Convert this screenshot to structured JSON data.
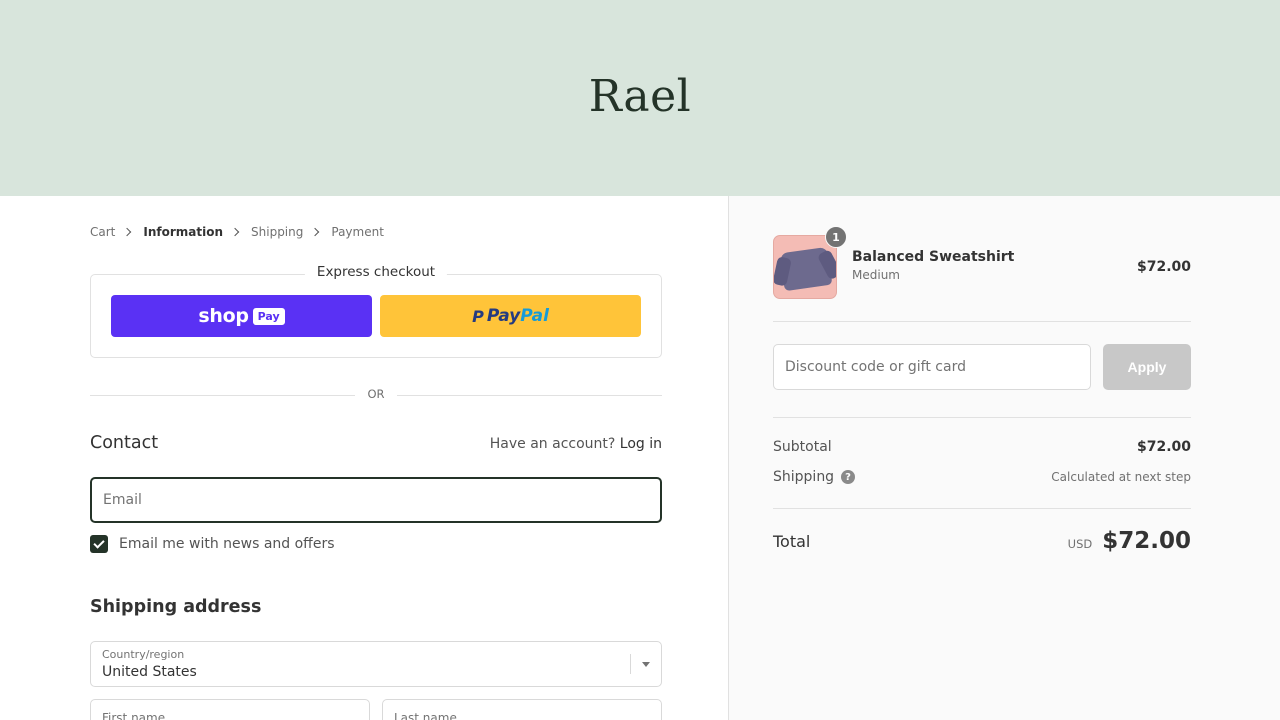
{
  "brand": {
    "name": "Rael"
  },
  "breadcrumb": [
    {
      "label": "Cart"
    },
    {
      "label": "Information"
    },
    {
      "label": "Shipping"
    },
    {
      "label": "Payment"
    }
  ],
  "express": {
    "title": "Express checkout",
    "shop_pay": {
      "word": "shop",
      "badge": "Pay"
    },
    "paypal": {
      "word1": "Pay",
      "word2": "Pal"
    }
  },
  "divider_text": "OR",
  "contact": {
    "heading": "Contact",
    "have_account": "Have an account?",
    "login_link": "Log in",
    "email_placeholder": "Email",
    "newsletter_label": "Email me with news and offers",
    "newsletter_checked": true
  },
  "shipping": {
    "heading": "Shipping address",
    "country_label": "Country/region",
    "country_value": "United States",
    "first_name_label": "First name",
    "last_name_label": "Last name"
  },
  "order": {
    "product": {
      "name": "Balanced Sweatshirt",
      "variant": "Medium",
      "price": "$72.00",
      "quantity": "1"
    },
    "discount_placeholder": "Discount code or gift card",
    "apply_label": "Apply",
    "subtotal_label": "Subtotal",
    "subtotal_value": "$72.00",
    "shipping_label": "Shipping",
    "shipping_value": "Calculated at next step",
    "total_label": "Total",
    "currency": "USD",
    "total_value": "$72.00"
  },
  "colors": {
    "banner": "#d8e5dc",
    "accent": "#243328",
    "shop_pay": "#5a31f4",
    "paypal": "#ffc439"
  }
}
